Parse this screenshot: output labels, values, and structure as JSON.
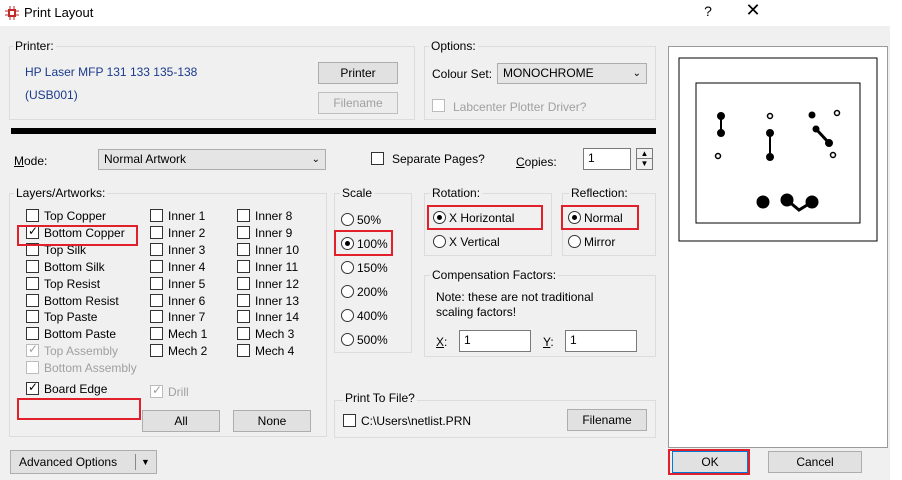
{
  "window": {
    "title": "Print Layout",
    "help": "?",
    "close": "✕"
  },
  "printer": {
    "group_label": "Printer:",
    "name_line1": "HP Laser MFP 131 133 135-138",
    "name_line2": "(USB001)",
    "printer_btn": "Printer",
    "filename_btn": "Filename"
  },
  "options": {
    "group_label": "Options:",
    "colour_set_label": "Colour Set:",
    "colour_set_value": "MONOCHROME",
    "plotter_label": "Labcenter Plotter Driver?"
  },
  "mode": {
    "label": "Mode:",
    "value": "Normal Artwork",
    "separate_pages": "Separate Pages?",
    "copies_label": "Copies:",
    "copies_value": "1"
  },
  "layers": {
    "group_label": "Layers/Artworks:",
    "col1": [
      {
        "label": "Top Copper",
        "checked": false,
        "disabled": false
      },
      {
        "label": "Bottom Copper",
        "checked": true,
        "disabled": false
      },
      {
        "label": "Top Silk",
        "checked": false,
        "disabled": false
      },
      {
        "label": "Bottom Silk",
        "checked": false,
        "disabled": false
      },
      {
        "label": "Top Resist",
        "checked": false,
        "disabled": false
      },
      {
        "label": "Bottom Resist",
        "checked": false,
        "disabled": false
      },
      {
        "label": "Top Paste",
        "checked": false,
        "disabled": false
      },
      {
        "label": "Bottom Paste",
        "checked": false,
        "disabled": false
      },
      {
        "label": "Top Assembly",
        "checked": true,
        "disabled": true
      },
      {
        "label": "Bottom Assembly",
        "checked": false,
        "disabled": true
      },
      {
        "label": "Board Edge",
        "checked": true,
        "disabled": false
      }
    ],
    "col2": [
      {
        "label": "Inner 1"
      },
      {
        "label": "Inner 2"
      },
      {
        "label": "Inner 3"
      },
      {
        "label": "Inner 4"
      },
      {
        "label": "Inner 5"
      },
      {
        "label": "Inner 6"
      },
      {
        "label": "Inner 7"
      },
      {
        "label": "Mech 1"
      },
      {
        "label": "Mech 2"
      }
    ],
    "drill_label": "Drill",
    "col3": [
      {
        "label": "Inner 8"
      },
      {
        "label": "Inner 9"
      },
      {
        "label": "Inner 10"
      },
      {
        "label": "Inner 11"
      },
      {
        "label": "Inner 12"
      },
      {
        "label": "Inner 13"
      },
      {
        "label": "Inner 14"
      },
      {
        "label": "Mech 3"
      },
      {
        "label": "Mech 4"
      }
    ],
    "all_btn": "All",
    "none_btn": "None"
  },
  "scale": {
    "group_label": "Scale",
    "options": [
      "50%",
      "100%",
      "150%",
      "200%",
      "400%",
      "500%"
    ],
    "selected": "100%"
  },
  "rotation": {
    "group_label": "Rotation:",
    "options": [
      "X Horizontal",
      "X Vertical"
    ],
    "selected": "X Horizontal"
  },
  "reflection": {
    "group_label": "Reflection:",
    "options": [
      "Normal",
      "Mirror"
    ],
    "selected": "Normal"
  },
  "compensation": {
    "group_label": "Compensation Factors:",
    "note_line1": "Note: these are not traditional",
    "note_line2": "scaling factors!",
    "x_label": "X:",
    "x_value": "1",
    "y_label": "Y:",
    "y_value": "1"
  },
  "print_to_file": {
    "group_label": "Print To File?",
    "path": "C:\\Users\\netlist.PRN",
    "filename_btn": "Filename"
  },
  "footer": {
    "advanced": "Advanced Options",
    "ok": "OK",
    "cancel": "Cancel"
  },
  "colors": {
    "highlight": "#e0202a",
    "printer_text": "#1a3a8c"
  }
}
